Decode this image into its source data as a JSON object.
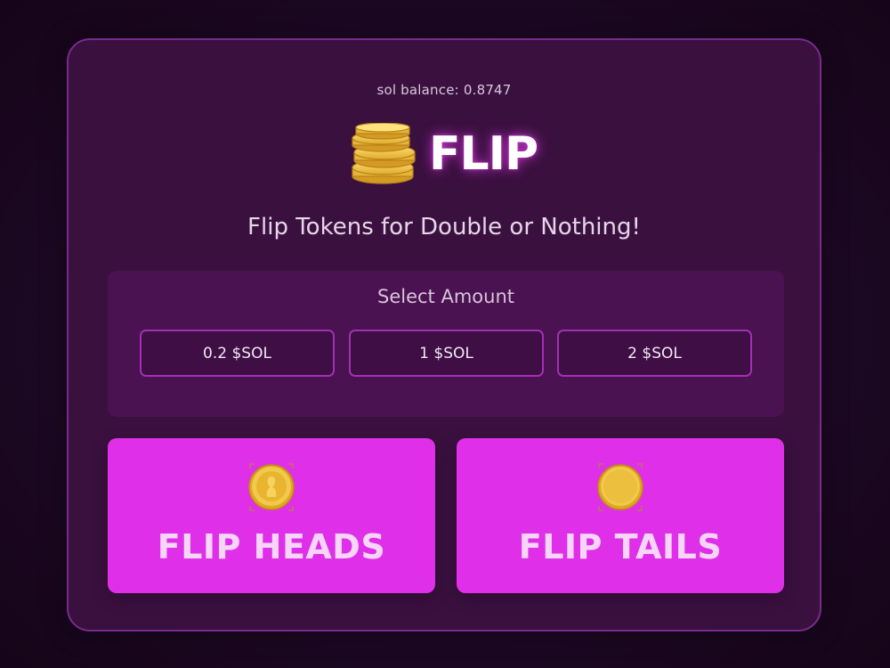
{
  "header": {
    "balance_text": "sol balance: 0.8747",
    "logo_text": "FLIP",
    "tagline": "Flip Tokens for Double or Nothing!"
  },
  "amount": {
    "title": "Select Amount",
    "options": [
      {
        "label": "0.2 $SOL"
      },
      {
        "label": "1 $SOL"
      },
      {
        "label": "2 $SOL"
      }
    ]
  },
  "actions": {
    "heads_label": "FLIP HEADS",
    "tails_label": "FLIP TAILS",
    "heads_icon": "coin-heads-icon",
    "tails_icon": "coin-tails-icon"
  },
  "colors": {
    "accent": "#e02fe8",
    "card_bg": "#3a103f",
    "panel_bg": "#4a1250",
    "border": "#a230b3"
  }
}
